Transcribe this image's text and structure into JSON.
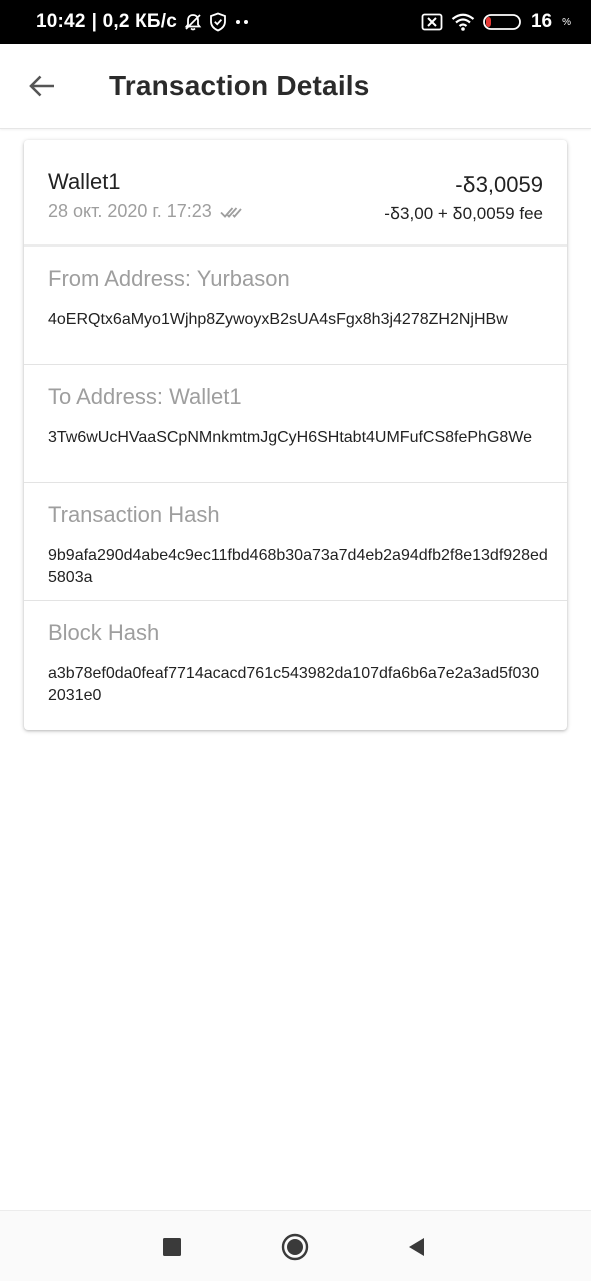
{
  "status_bar": {
    "time": "10:42",
    "network_info": "| 0,2 КБ/с",
    "battery_level": "16",
    "battery_unit": "%",
    "icons": [
      "muted-bell-icon",
      "shield-icon",
      "more-dots-icon",
      "sim-x-icon",
      "wifi-icon",
      "battery-icon"
    ]
  },
  "header": {
    "title": "Transaction Details",
    "back_icon": "arrow-left-icon"
  },
  "transaction": {
    "wallet_name": "Wallet1",
    "date": "28 окт. 2020 г. 17:23",
    "status_icon": "double-check-icon",
    "amount": "-Ᵹ3,0059",
    "amount_breakdown": "-Ᵹ3,00 + Ᵹ0,0059 fee"
  },
  "sections": [
    {
      "label": "From Address: Yurbason",
      "value": "4oERQtx6aMyo1Wjhp8ZywoyxB2sUA4sFgx8h3j4278ZH2NjHBw"
    },
    {
      "label": "To Address: Wallet1",
      "value": "3Tw6wUcHVaaSCpNMnkmtmJgCyH6SHtabt4UMFufCS8fePhG8We"
    },
    {
      "label": "Transaction Hash",
      "value": "9b9afa290d4abe4c9ec11fbd468b30a73a7d4eb2a94dfb2f8e13df928ed5803a"
    },
    {
      "label": "Block Hash",
      "value": "a3b78ef0da0feaf7714acacd761c543982da107dfa6b6a7e2a3ad5f0302031e0"
    }
  ],
  "nav_bar": {
    "icons": [
      "recents-square-icon",
      "home-circle-icon",
      "back-triangle-icon"
    ]
  }
}
